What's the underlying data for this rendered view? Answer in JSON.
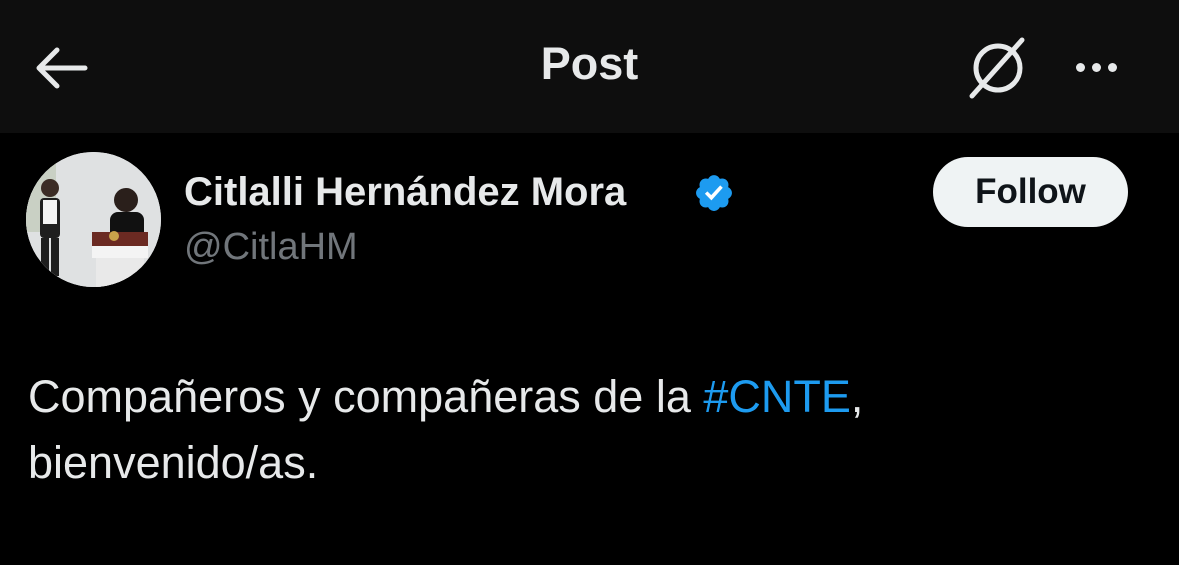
{
  "header": {
    "title": "Post",
    "back_icon": "arrow-left-icon",
    "grok_icon": "grok-icon",
    "more_icon": "more-horizontal-icon"
  },
  "author": {
    "display_name": "Citlalli Hernández Mora",
    "handle": "@CitlaHM",
    "verified": true,
    "verified_color": "#1d9bf0"
  },
  "follow_button": {
    "label": "Follow"
  },
  "post": {
    "text_before": "Compañeros y compañeras de la ",
    "hashtag": "#CNTE",
    "text_after_line1": ",",
    "line2": "bienvenido/as."
  },
  "colors": {
    "background": "#000000",
    "header_background": "#0e0e0e",
    "text": "#e7e9ea",
    "secondary_text": "#71767b",
    "link": "#1d9bf0"
  }
}
